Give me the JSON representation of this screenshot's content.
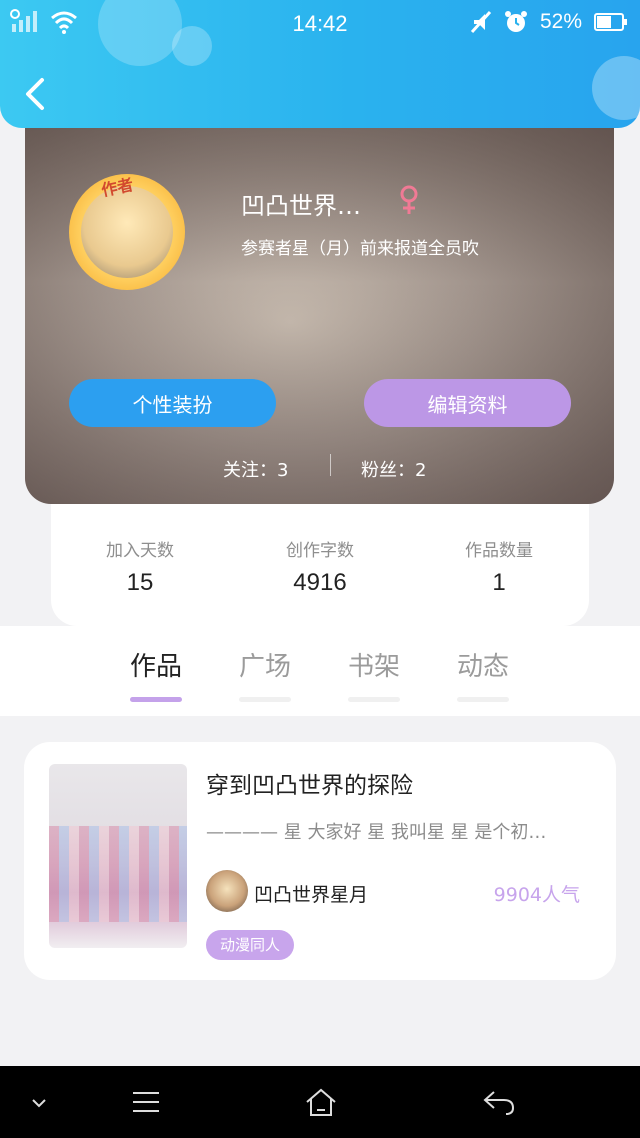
{
  "status_bar": {
    "time": "14:42",
    "battery": "52%",
    "icons": [
      "signal-icon",
      "wifi-icon",
      "mute-icon",
      "alarm-icon",
      "battery-icon"
    ]
  },
  "header": {
    "back_icon": "chevron-left-icon",
    "accent_color": "#2ab2ee"
  },
  "profile": {
    "author_badge": "作者",
    "username": "凹凸世界…",
    "gender_icon": "female-icon",
    "bio": "参赛者星（月）前来报道全员吹",
    "buttons": {
      "customize": "个性装扮",
      "edit_profile": "编辑资料"
    },
    "following": "关注：3",
    "followers": "粉丝：2"
  },
  "stats": [
    {
      "label": "加入天数",
      "value": "15"
    },
    {
      "label": "创作字数",
      "value": "4916"
    },
    {
      "label": "作品数量",
      "value": "1"
    }
  ],
  "tabs": [
    {
      "label": "作品",
      "active": true
    },
    {
      "label": "广场",
      "active": false
    },
    {
      "label": "书架",
      "active": false
    },
    {
      "label": "动态",
      "active": false
    }
  ],
  "work": {
    "title": "穿到凹凸世界的探险",
    "description": "———— 星 大家好 星 我叫星 星 是个初…",
    "author": "凹凸世界星月",
    "popularity": "9904人气",
    "tag": "动漫同人"
  },
  "nav_bar": {
    "icons": [
      "chevron-down-icon",
      "menu-icon",
      "home-icon",
      "back-arrow-icon"
    ]
  }
}
